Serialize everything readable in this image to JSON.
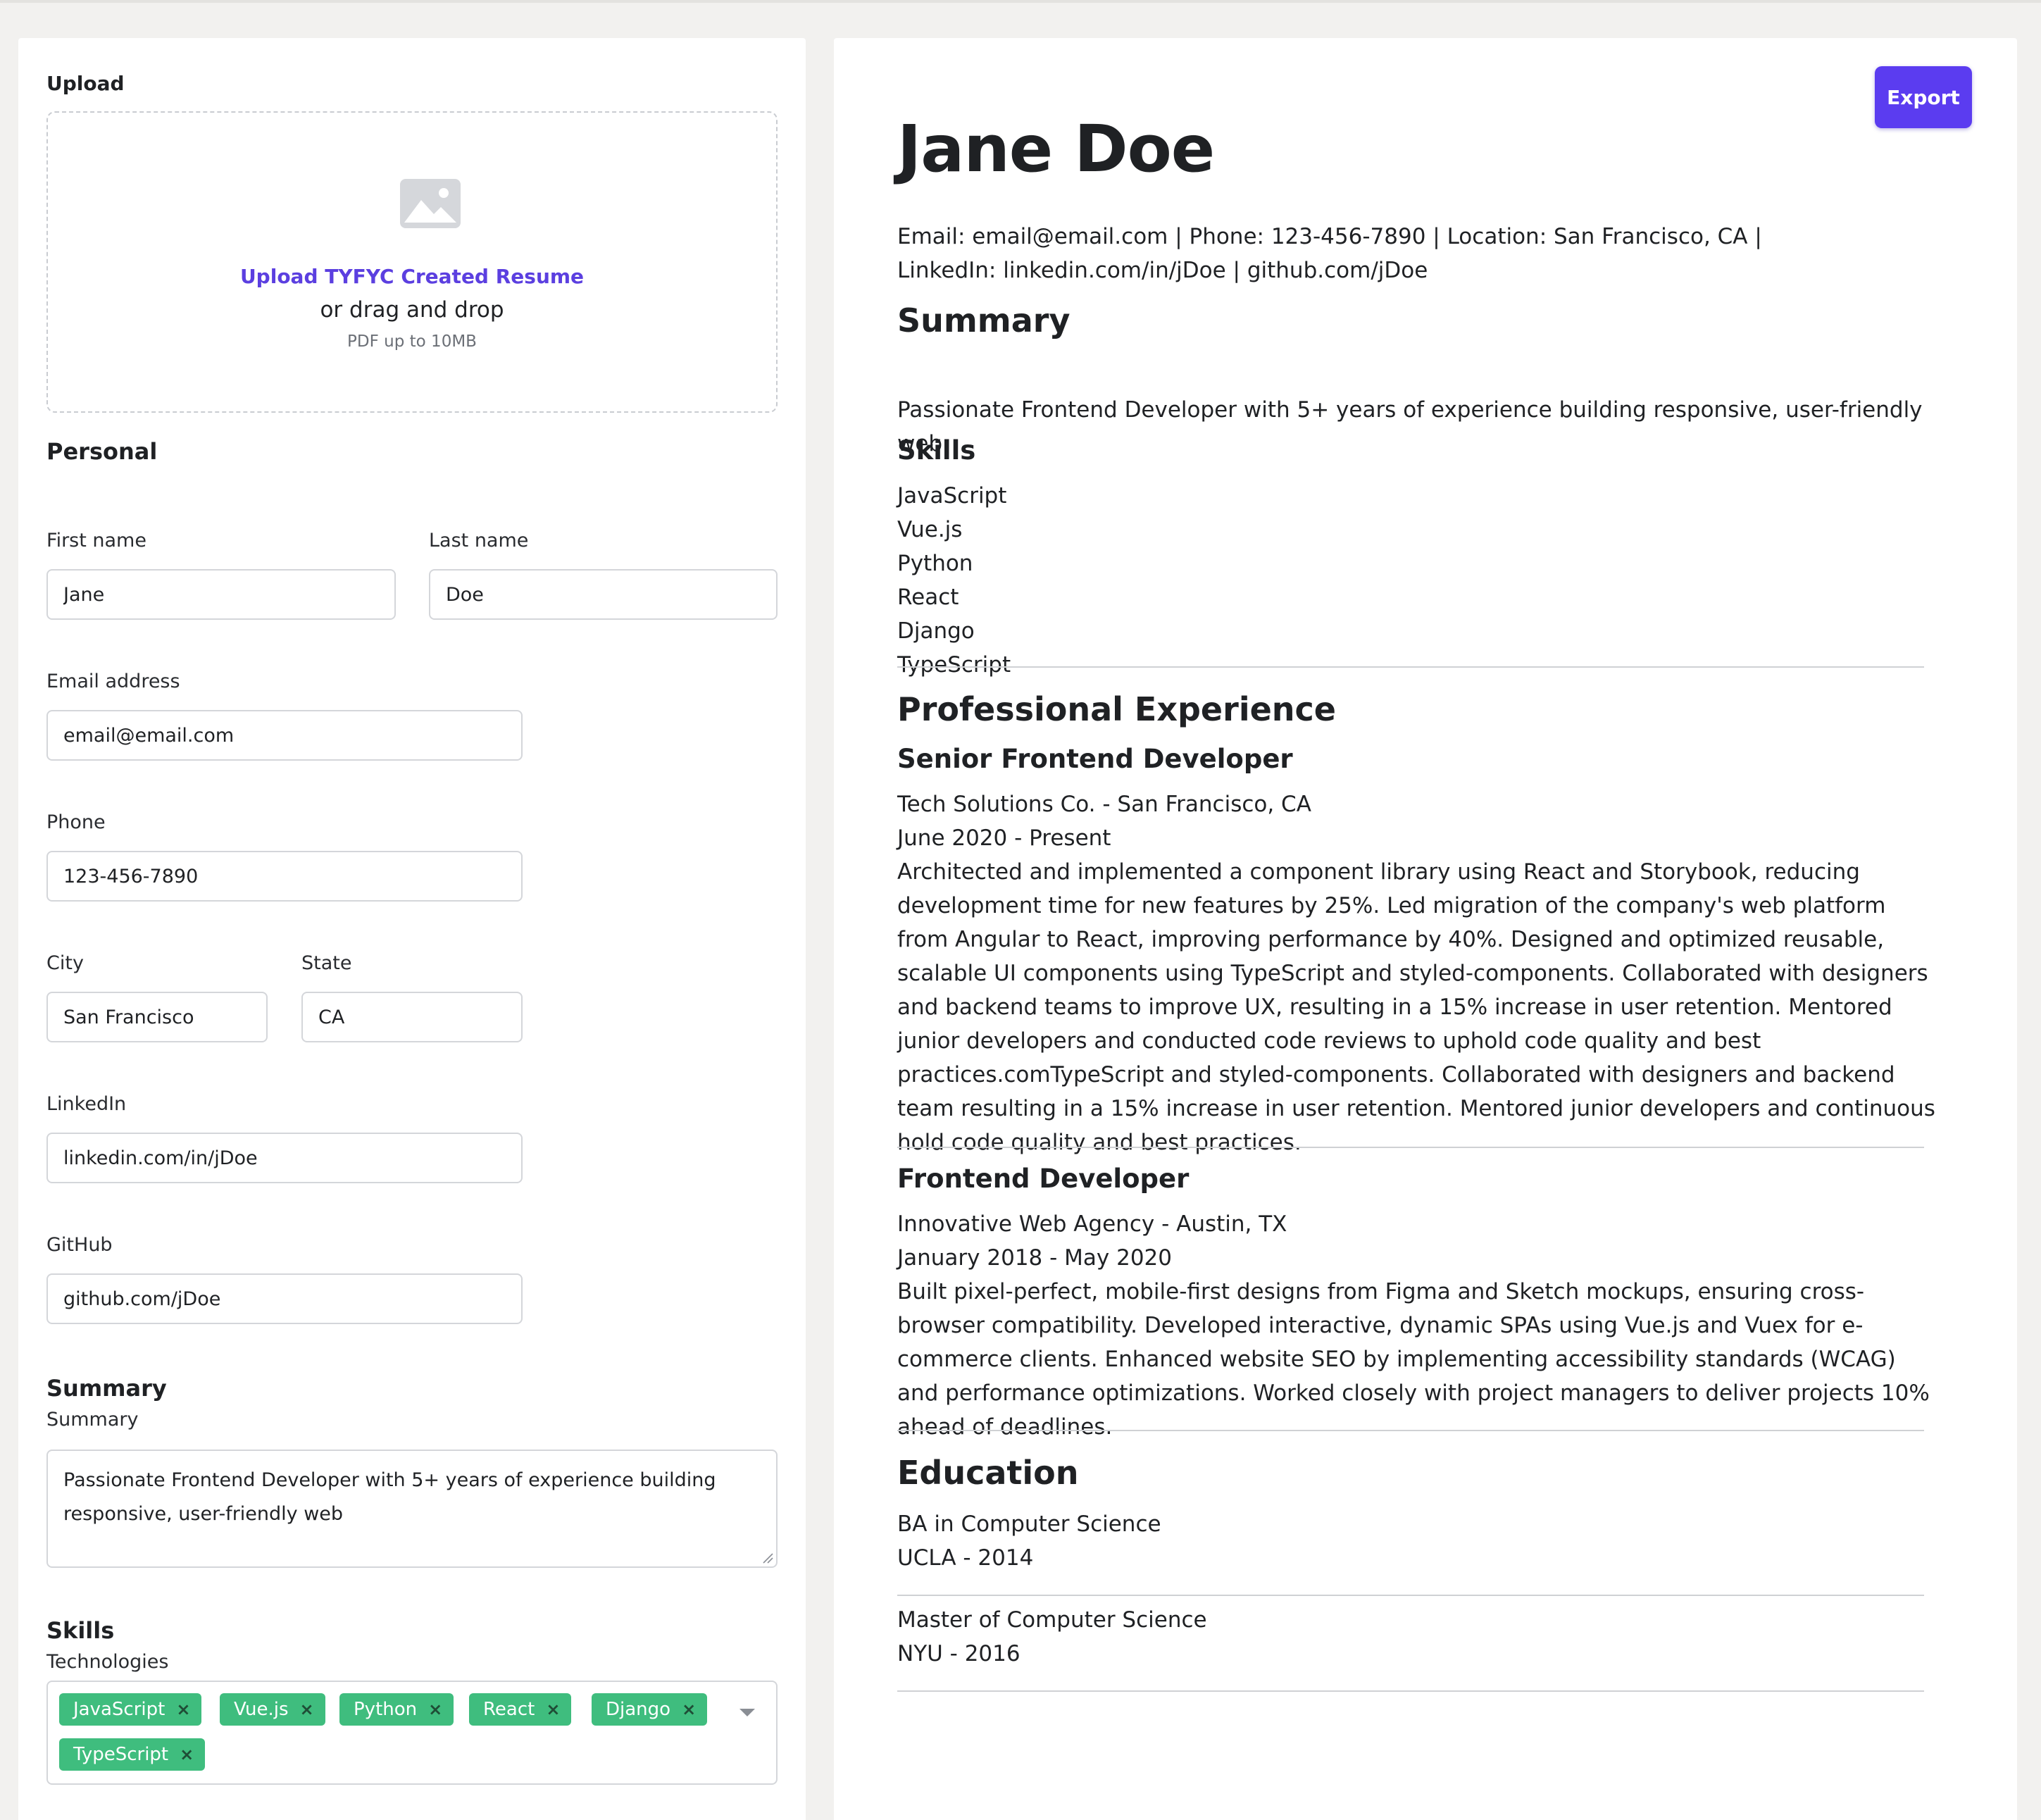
{
  "form": {
    "upload_label": "Upload",
    "dropzone": {
      "link": "Upload TYFYC Created Resume",
      "or": "or drag and drop",
      "hint": "PDF up to 10MB"
    },
    "personal_heading": "Personal",
    "first_name_label": "First name",
    "first_name_value": "Jane",
    "last_name_label": "Last name",
    "last_name_value": "Doe",
    "email_label": "Email address",
    "email_value": "email@email.com",
    "phone_label": "Phone",
    "phone_value": "123-456-7890",
    "city_label": "City",
    "city_value": "San Francisco",
    "state_label": "State",
    "state_value": "CA",
    "linkedin_label": "LinkedIn",
    "linkedin_value": "linkedin.com/in/jDoe",
    "github_label": "GitHub",
    "github_value": "github.com/jDoe",
    "summary_heading": "Summary",
    "summary_label": "Summary",
    "summary_value": "Passionate Frontend Developer with 5+ years of experience building responsive, user-friendly web",
    "skills_heading": "Skills",
    "technologies_label": "Technologies",
    "tags": [
      "JavaScript",
      "Vue.js",
      "Python",
      "React",
      "Django",
      "TypeScript"
    ],
    "tag_remove_symbol": "×"
  },
  "preview": {
    "export_label": "Export",
    "name": "Jane Doe",
    "contact_line1": "Email: email@email.com | Phone: 123-456-7890 | Location: San Francisco, CA |",
    "contact_line2": "LinkedIn: linkedin.com/in/jDoe | github.com/jDoe",
    "summary_heading": "Summary",
    "summary_text": "Passionate Frontend Developer with 5+ years of experience building responsive, user-friendly web",
    "skills_heading": "Skills",
    "skills": [
      "JavaScript",
      "Vue.js",
      "Python",
      "React",
      "Django",
      "TypeScript"
    ],
    "experience_heading": "Professional Experience",
    "jobs": [
      {
        "title": "Senior Frontend Developer",
        "company": "Tech Solutions Co. - San Francisco, CA",
        "dates": "June 2020 - Present",
        "description": "Architected and implemented a component library using React and Storybook, reducing development time for new features by 25%. Led migration of the company's web platform from Angular to React, improving performance by 40%. Designed and optimized reusable, scalable UI components using TypeScript and styled-components. Collaborated with designers and backend teams to improve UX, resulting in a 15% increase in user retention. Mentored junior developers and conducted code reviews to uphold code quality and best practices.comTypeScript and styled-components. Collaborated with designers and backend team resulting in a 15% increase in user retention. Mentored junior developers and continuous hold code quality and best practices."
      },
      {
        "title": "Frontend Developer",
        "company": "Innovative Web Agency - Austin, TX",
        "dates": "January 2018 - May 2020",
        "description": "Built pixel-perfect, mobile-first designs from Figma and Sketch mockups, ensuring cross-browser compatibility. Developed interactive, dynamic SPAs using Vue.js and Vuex for e-commerce clients. Enhanced website SEO by implementing accessibility standards (WCAG) and performance optimizations. Worked closely with project managers to deliver projects 10% ahead of deadlines."
      }
    ],
    "education_heading": "Education",
    "education": [
      {
        "degree": "BA in Computer Science",
        "school": "UCLA - 2014"
      },
      {
        "degree": "Master of Computer Science",
        "school": "NYU - 2016"
      }
    ]
  }
}
